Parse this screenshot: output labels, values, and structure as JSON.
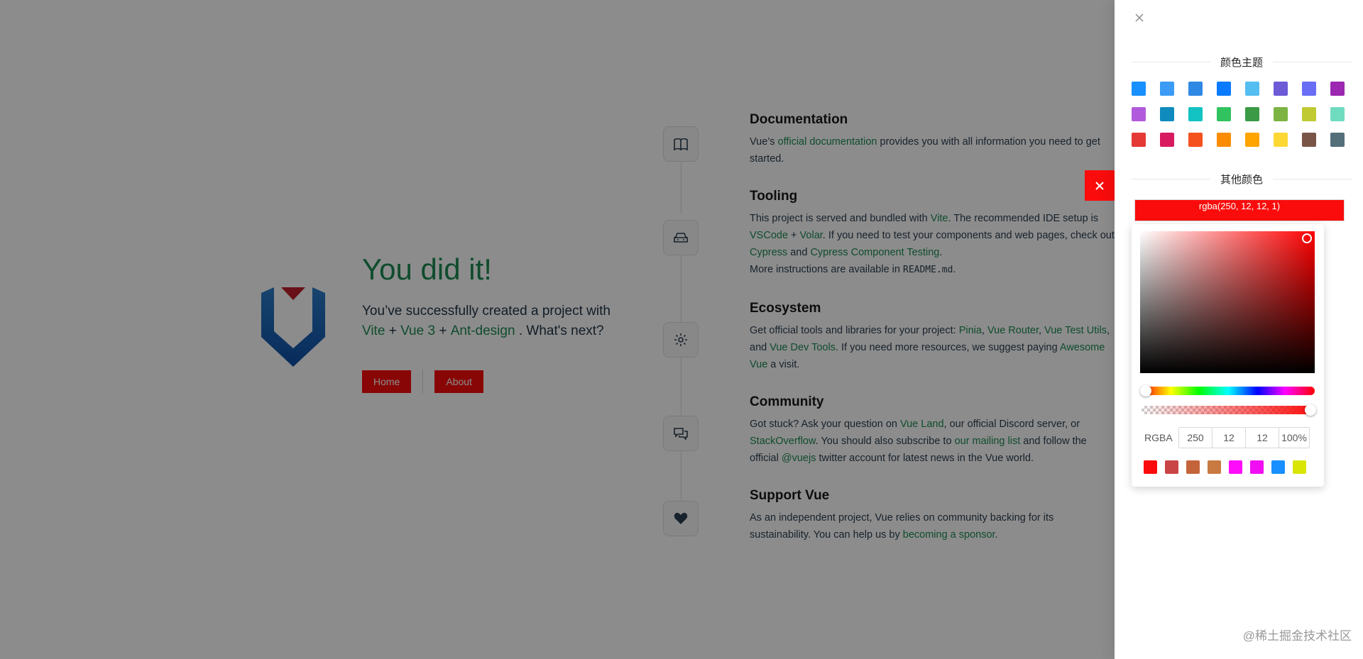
{
  "hero": {
    "title": "You did it!",
    "subtitle_prefix": "You’ve successfully created a project with",
    "link_vite": "Vite",
    "plus1": "+",
    "link_vue3": "Vue 3",
    "plus2": "+",
    "link_antd": "Ant-design",
    "subtitle_suffix": ". What's next?",
    "home_label": "Home",
    "about_label": "About"
  },
  "items": {
    "documentation": {
      "title": "Documentation",
      "t1": "Vue’s ",
      "l1": "official documentation",
      "t2": " provides you with all information you need to get started."
    },
    "tooling": {
      "title": "Tooling",
      "t1": "This project is served and bundled with ",
      "l1": "Vite",
      "t2": ". The recommended IDE setup is ",
      "l2": "VSCode",
      "t3": " + ",
      "l3": "Volar",
      "t4": ". If you need to test your components and web pages, check out ",
      "l4": "Cypress",
      "t5": " and ",
      "l5": "Cypress Component Testing",
      "t6": ".",
      "t7": "More instructions are available in ",
      "code": "README.md",
      "t8": "."
    },
    "ecosystem": {
      "title": "Ecosystem",
      "t1": "Get official tools and libraries for your project: ",
      "l1": "Pinia",
      "t2": ", ",
      "l2": "Vue Router",
      "t3": ", ",
      "l3": "Vue Test Utils",
      "t4": ", and ",
      "l4": "Vue Dev Tools",
      "t5": ". If you need more resources, we suggest paying ",
      "l5": "Awesome Vue",
      "t6": " a visit."
    },
    "community": {
      "title": "Community",
      "t1": "Got stuck? Ask your question on ",
      "l1": "Vue Land",
      "t2": ", our official Discord server, or ",
      "l2": "StackOverflow",
      "t3": ". You should also subscribe to ",
      "l3": "our mailing list",
      "t4": " and follow the official ",
      "l4": "@vuejs",
      "t5": " twitter account for latest news in the Vue world."
    },
    "support": {
      "title": "Support Vue",
      "t1": "As an independent project, Vue relies on community backing for its sustainability. You can help us by ",
      "l1": "becoming a sponsor",
      "t2": "."
    }
  },
  "drawer": {
    "theme_heading": "颜色主题",
    "other_heading": "其他颜色",
    "theme_colors": [
      "#1890ff",
      "#3c9cf5",
      "#2f89e4",
      "#0a7aff",
      "#55bef0",
      "#6d5ad6",
      "#6a6ef5",
      "#9c27b0",
      "#b15bdc",
      "#0f8bbd",
      "#13c2c2",
      "#31c35f",
      "#3a9a45",
      "#7cb342",
      "#c0ca33",
      "#6fdcc0",
      "#e53935",
      "#d81b60",
      "#f4511e",
      "#fb8c00",
      "#ffa400",
      "#fdd835",
      "#795548",
      "#546e7a"
    ],
    "current_color_text": "rgba(250, 12, 12, 1)",
    "current_color": "#fa0c0c",
    "picker": {
      "mode_label": "RGBA",
      "r": "250",
      "g": "12",
      "b": "12",
      "a": "100%",
      "hue_level": 0,
      "alpha_level": 1,
      "presets": [
        "#fa0c0c",
        "#c94444",
        "#c4643a",
        "#c97a40",
        "#ff0bfb",
        "#f10ef2",
        "#1890ff",
        "#d8e505"
      ]
    }
  },
  "watermark": "@稀土掘金技术社区"
}
